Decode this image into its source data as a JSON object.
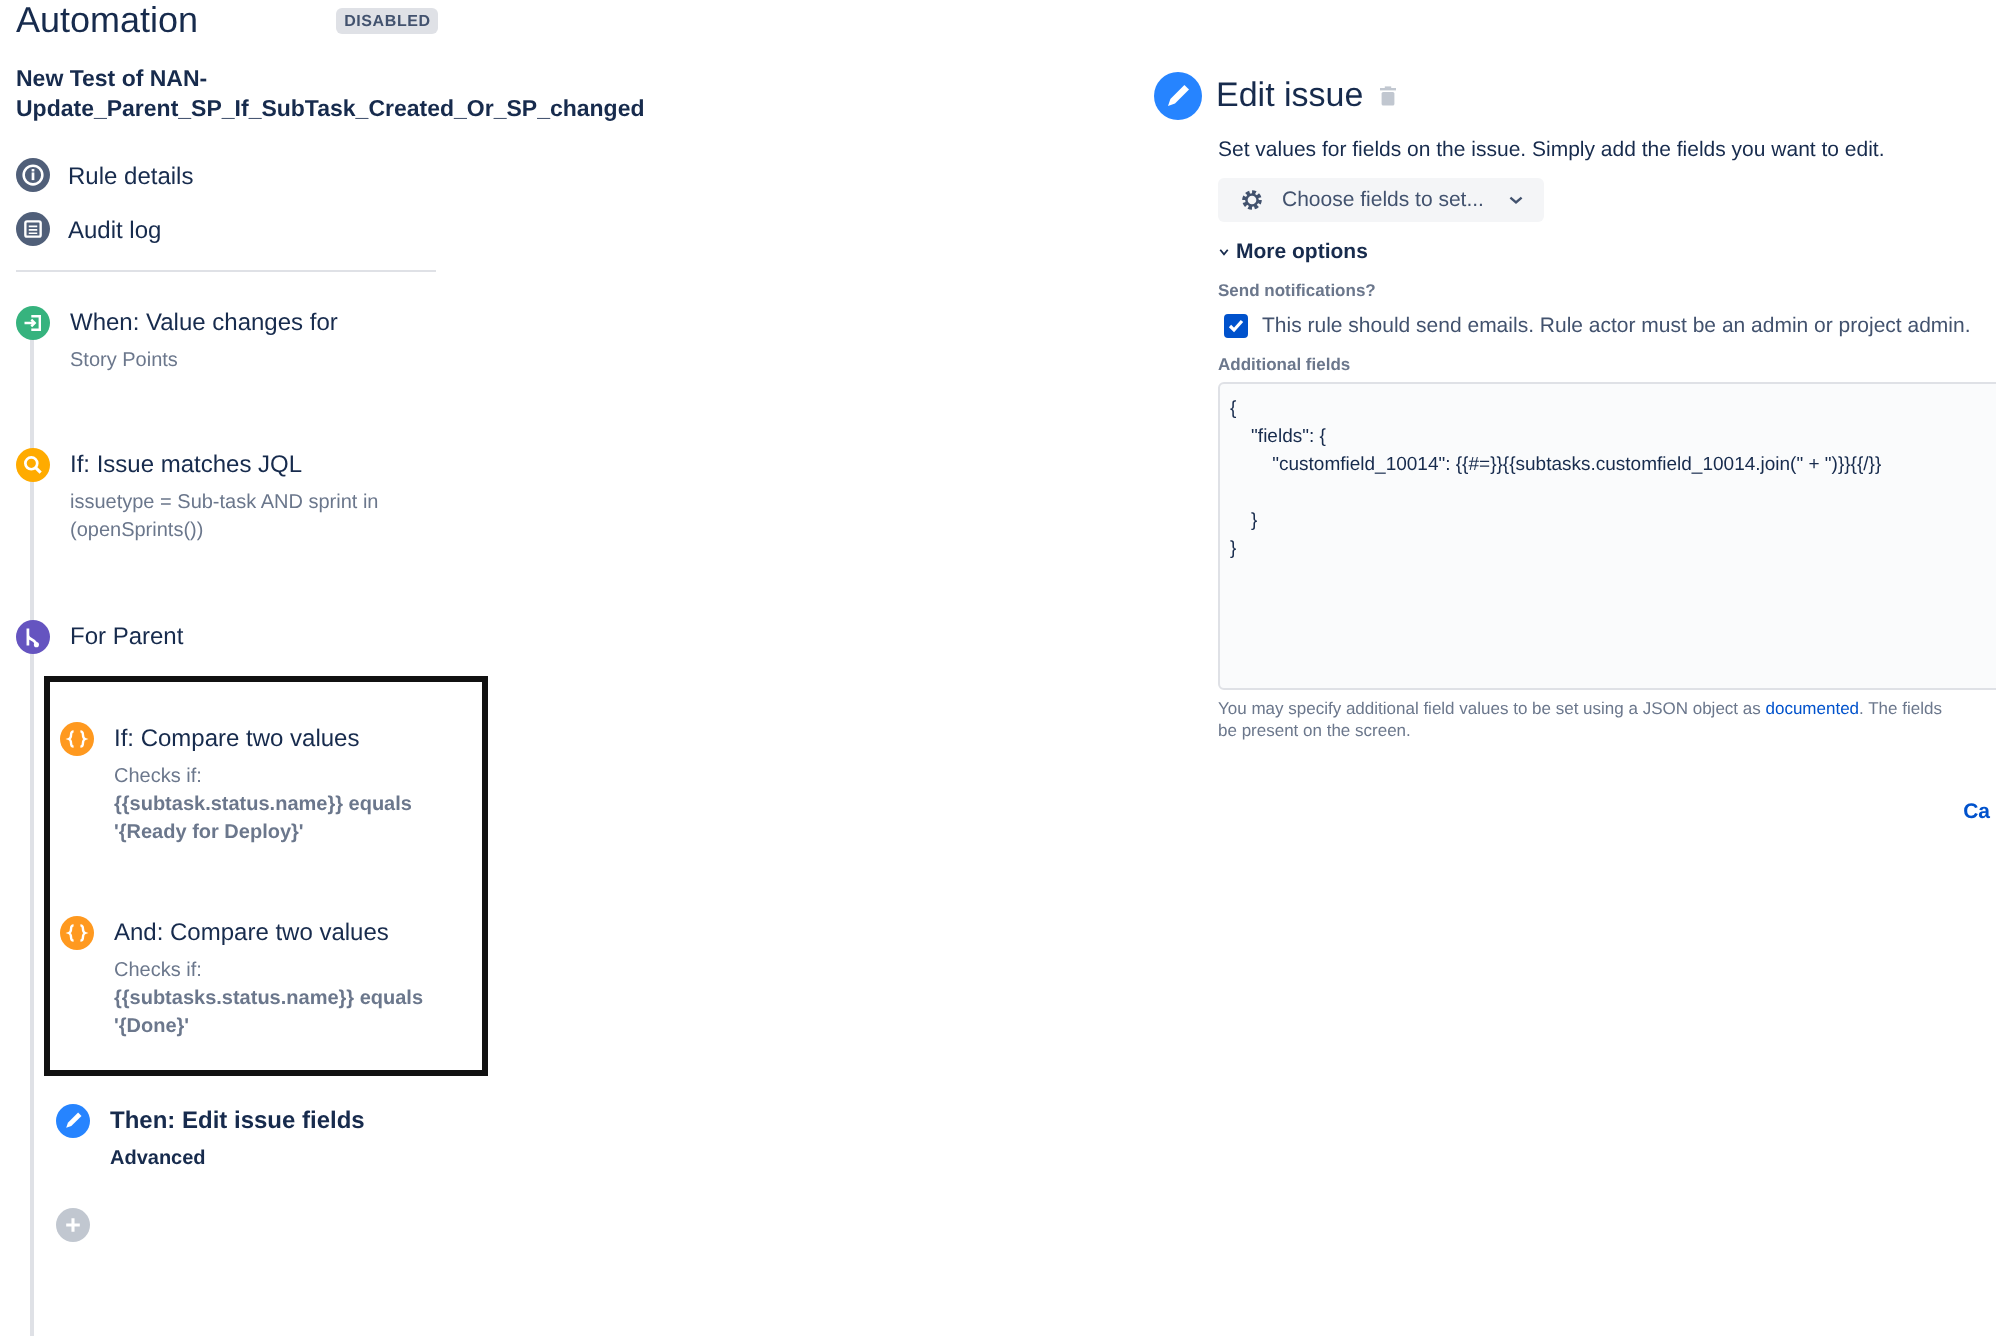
{
  "header": {
    "title": "Automation",
    "status_badge": "DISABLED"
  },
  "rule_name": "New Test of NAN-Update_Parent_SP_If_SubTask_Created_Or_SP_changed",
  "nav": [
    {
      "kind": "info",
      "label": "Rule details"
    },
    {
      "kind": "log",
      "label": "Audit log"
    }
  ],
  "steps": [
    {
      "kind": "trigger",
      "title": "When: Value changes for",
      "details": [
        "Story Points"
      ]
    },
    {
      "kind": "condition",
      "title": "If: Issue matches JQL",
      "details": [
        "issuetype = Sub-task AND sprint in (openSprints())"
      ]
    },
    {
      "kind": "branch",
      "title": "For Parent"
    },
    {
      "kind": "group",
      "steps": [
        {
          "kind": "compare",
          "title": "If: Compare two values",
          "details": [
            "Checks if:"
          ],
          "expression": "{{subtask.status.name}} equals '{Ready for Deploy}'"
        },
        {
          "kind": "compare",
          "title": "And: Compare two values",
          "details": [
            "Checks if:"
          ],
          "expression": "{{subtasks.status.name}} equals '{Done}'"
        }
      ]
    },
    {
      "kind": "action",
      "title": "Then: Edit issue fields",
      "expression": "Advanced"
    },
    {
      "kind": "add"
    }
  ],
  "panel": {
    "title": "Edit issue",
    "description": "Set values for fields on the issue. Simply add the fields you want to edit.",
    "choose_button": "Choose fields to set...",
    "more_options": {
      "label": "More options",
      "expanded": true
    },
    "notifications_label": "Send notifications?",
    "notify": {
      "label": "This rule should send emails. Rule actor must be an admin or project admin.",
      "checked": true
    },
    "additional_label": "Additional fields",
    "json_lines": [
      {
        "text": "{"
      },
      {
        "text": "    \"fields\": {"
      },
      {
        "text": "        \"customfield_10014\": {{#=}}{{subtasks.customfield_10014.join(\" + \")}}{{/}}",
        "blank_after": true
      },
      {
        "text": "    }"
      },
      {
        "text": "}"
      }
    ],
    "help_before": "You may specify additional field values to be set using a JSON object as",
    "help_link": "documented",
    "help_after": ". The fields",
    "help_line2": "be present on the screen.",
    "cancel": "Ca"
  }
}
